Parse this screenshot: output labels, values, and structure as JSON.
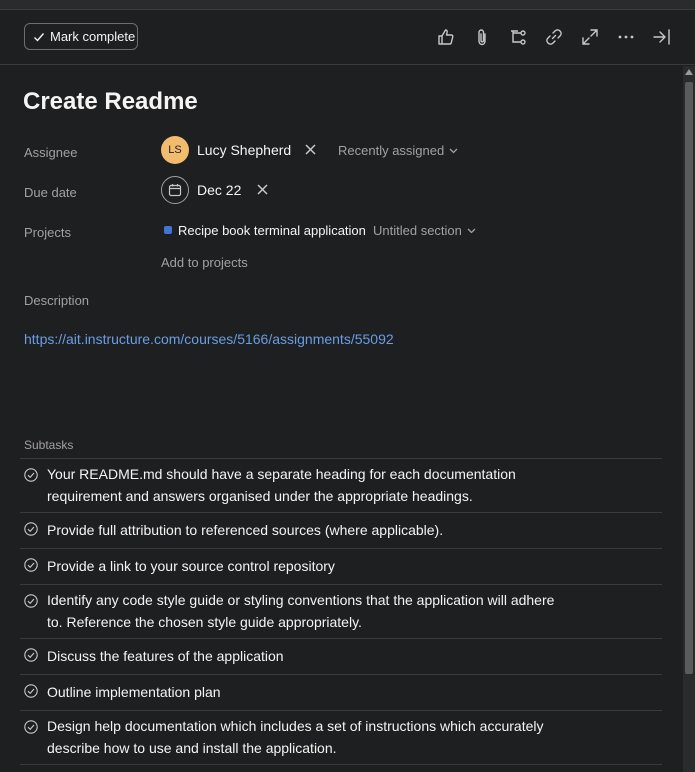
{
  "toolbar": {
    "mark_complete_label": "Mark complete",
    "icons": [
      "like-icon",
      "attachment-icon",
      "subtask-icon",
      "link-icon",
      "expand-icon",
      "more-icon",
      "close-panel-icon"
    ]
  },
  "task": {
    "title": "Create Readme",
    "fields": {
      "assignee_label": "Assignee",
      "assignee_initials": "LS",
      "assignee_name": "Lucy Shepherd",
      "assignee_dropdown": "Recently assigned",
      "due_label": "Due date",
      "due_value": "Dec 22",
      "projects_label": "Projects",
      "project_name": "Recipe book terminal application",
      "section_dropdown": "Untitled section",
      "add_to_projects": "Add to projects",
      "description_label": "Description",
      "description_link": "https://ait.instructure.com/courses/5166/assignments/55092"
    },
    "subtasks_label": "Subtasks",
    "subtasks": [
      "Your README.md should have a separate heading for each documentation requirement and answers organised under the appropriate headings.",
      "Provide full attribution to referenced sources (where applicable).",
      "Provide a link to your source control repository",
      "Identify any code style guide or styling conventions that the application will adhere to. Reference the chosen style guide appropriately.",
      "Discuss the features of the application",
      "Outline implementation plan",
      "Design help documentation which includes a set of instructions which accurately describe how to use and install the application."
    ]
  },
  "colors": {
    "background": "#1e1f21",
    "avatar": "#f1bd6c",
    "project_dot": "#4573d2",
    "link": "#6a9de3"
  }
}
